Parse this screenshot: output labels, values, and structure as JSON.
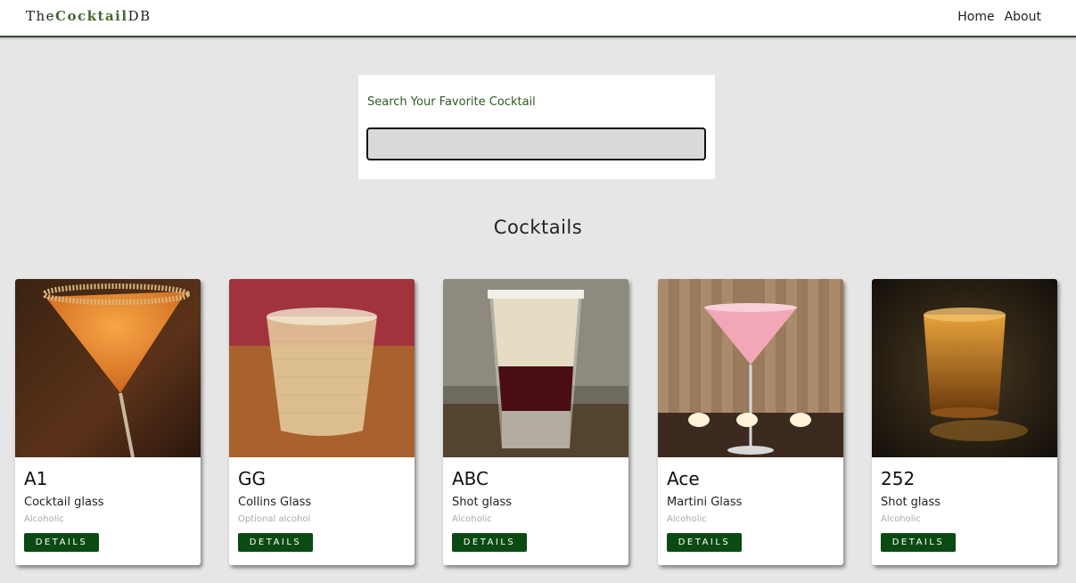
{
  "header": {
    "logo_prefix": "The",
    "logo_brand": "Cocktail",
    "logo_suffix": "DB",
    "nav": {
      "home": "Home",
      "about": "About"
    }
  },
  "search": {
    "label": "Search Your Favorite Cocktail",
    "value": "",
    "placeholder": ""
  },
  "section_title": "Cocktails",
  "colors": {
    "accent": "#0b4a12",
    "brand": "#476a30",
    "background": "#e6e6e6"
  },
  "cocktails": [
    {
      "name": "A1",
      "glass": "Cocktail glass",
      "alcoholic": "Alcoholic",
      "button": "DETAILS",
      "image": "martini-orange-photo"
    },
    {
      "name": "GG",
      "glass": "Collins Glass",
      "alcoholic": "Optional alcohol",
      "button": "DETAILS",
      "image": "tumbler-photo"
    },
    {
      "name": "ABC",
      "glass": "Shot glass",
      "alcoholic": "Alcoholic",
      "button": "DETAILS",
      "image": "layered-shot-photo"
    },
    {
      "name": "Ace",
      "glass": "Martini Glass",
      "alcoholic": "Alcoholic",
      "button": "DETAILS",
      "image": "pink-martini-photo"
    },
    {
      "name": "252",
      "glass": "Shot glass",
      "alcoholic": "Alcoholic",
      "button": "DETAILS",
      "image": "whiskey-shot-photo"
    }
  ]
}
